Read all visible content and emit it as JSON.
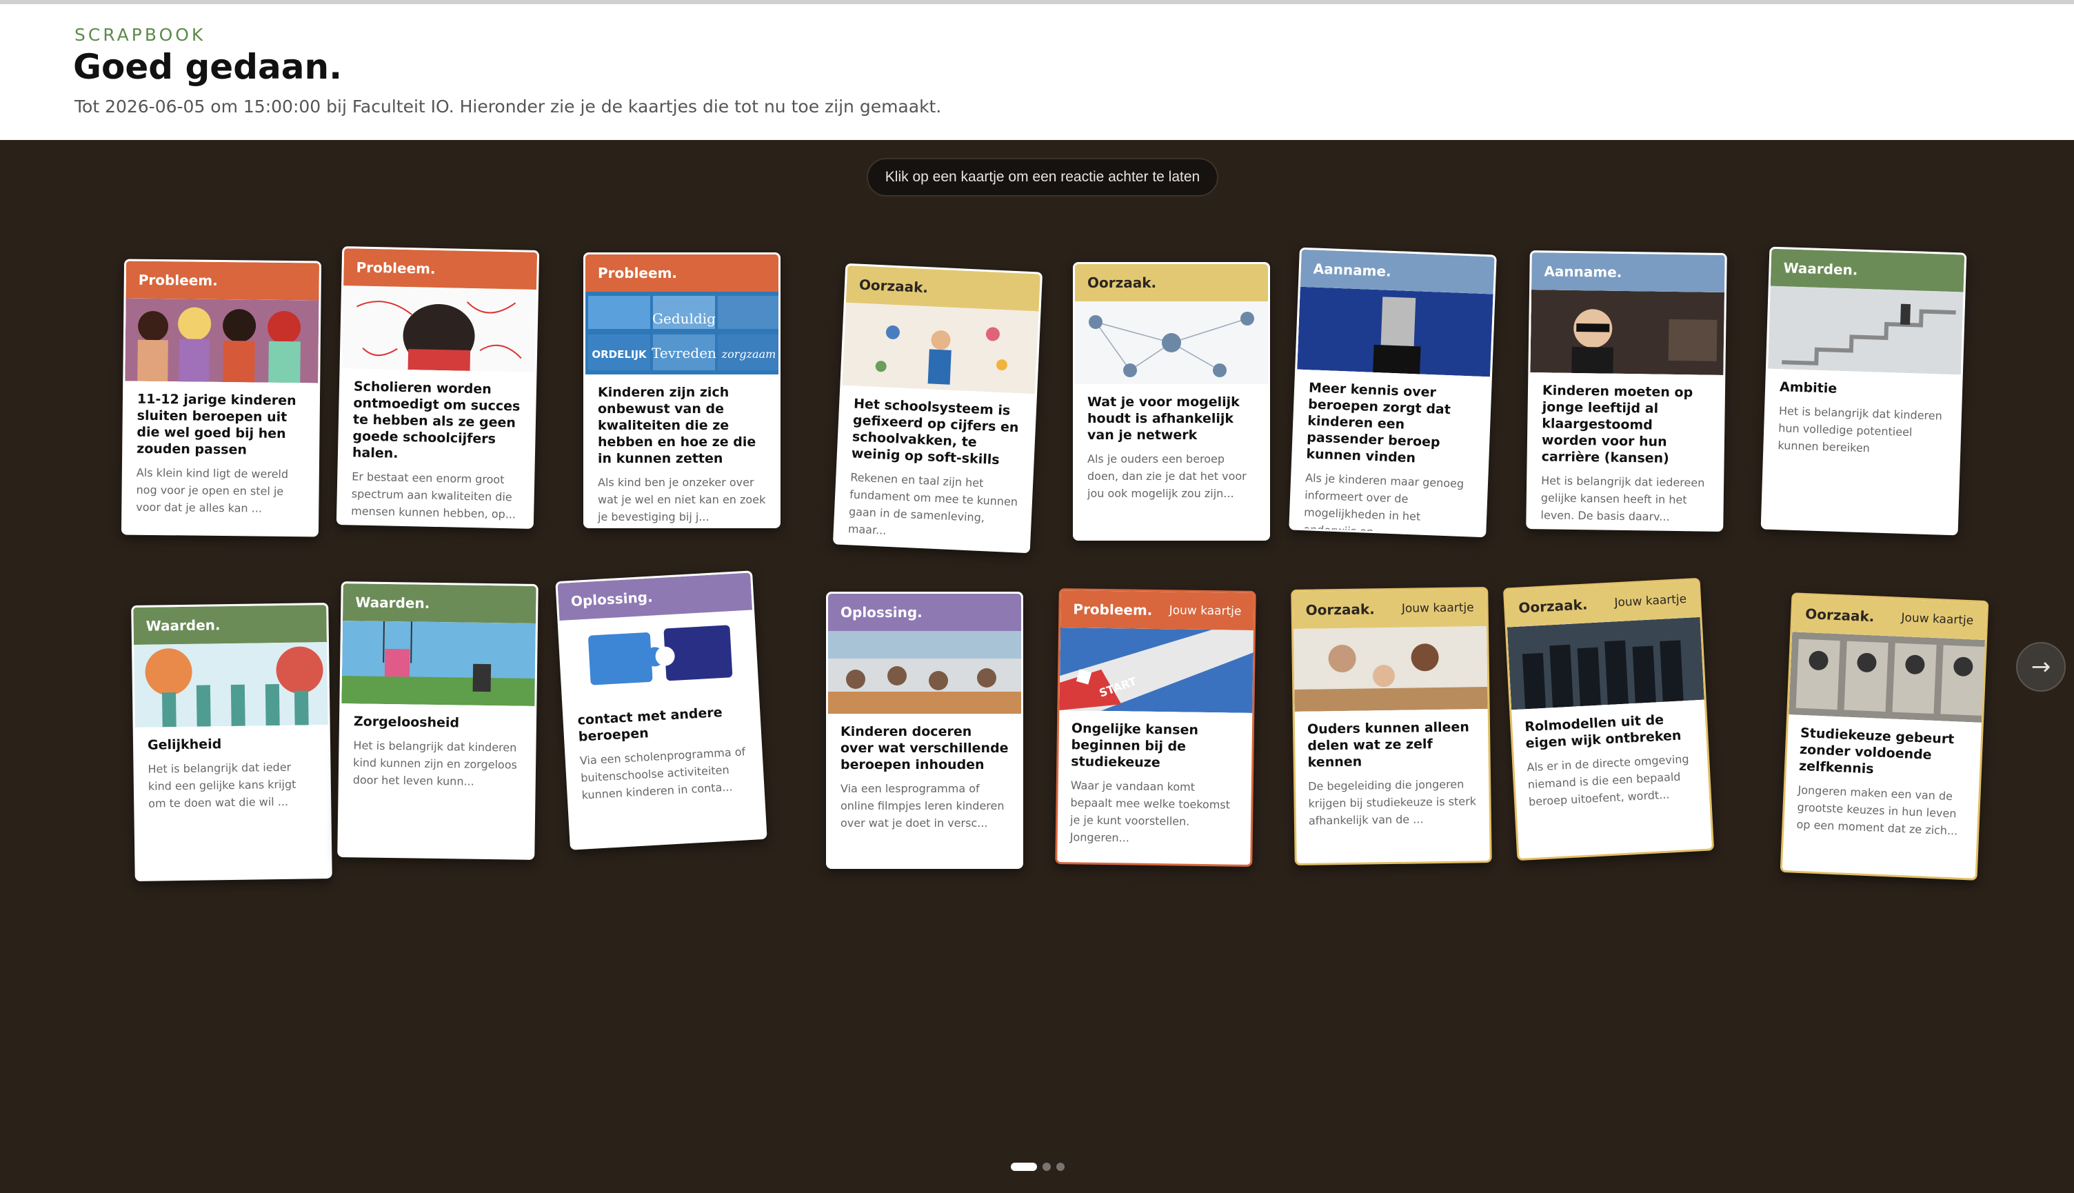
{
  "header": {
    "eyebrow": "SCRAPBOOK",
    "title": "Goed gedaan.",
    "subtitle": "Tot 2026-06-05 om 15:00:00 bij Faculteit IO. Hieronder zie je de kaartjes die tot nu toe zijn gemaakt."
  },
  "board": {
    "hint": "Klik op een kaartje om een reactie achter te laten",
    "next_icon": "arrow-right-icon",
    "next_glyph": "→",
    "pagination": {
      "pages": 3,
      "current": 1
    }
  },
  "colors": {
    "probleem": "#d9663c",
    "oorzaak": "#e3c874",
    "aanname": "#7a9cc2",
    "waarden": "#6b8c57",
    "oplossing": "#8f79b3",
    "background": "#2a2119"
  },
  "cards": [
    {
      "category": "Probleem.",
      "mine": "",
      "title": "11-12 jarige kinderen sluiten beroepen uit die wel goed bij hen zouden passen",
      "body": "Als klein kind ligt de wereld nog voor je open en stel je voor dat je alles kan ...",
      "image": "princesses"
    },
    {
      "category": "Probleem.",
      "mine": "",
      "title": "Scholieren worden ontmoedigt om succes te hebben als ze geen goede schoolcijfers halen.",
      "body": "Er bestaat een enorm groot spectrum aan kwaliteiten die mensen kunnen hebben, op...",
      "image": "sad-student"
    },
    {
      "category": "Probleem.",
      "mine": "",
      "title": "Kinderen zijn zich onbewust van de kwaliteiten die ze hebben en hoe ze die in kunnen zetten",
      "body": "Als kind ben je onzeker over wat je wel en niet kan en zoek je bevestiging bij j...",
      "image": "quality-cards",
      "image_words": [
        "Geduldig",
        "ORDELIJK",
        "Tevreden",
        "zorgzaam"
      ]
    },
    {
      "category": "Oorzaak.",
      "mine": "",
      "title": "Het schoolsysteem is gefixeerd op cijfers en schoolvakken, te weinig op soft-skills",
      "body": "Rekenen en taal zijn het fundament om mee te kunnen gaan in de samenleving, maar...",
      "image": "skills-illustration"
    },
    {
      "category": "Oorzaak.",
      "mine": "",
      "title": "Wat je voor mogelijk houdt is afhankelijk van je netwerk",
      "body": "Als je ouders een beroep doen, dan zie je dat het voor jou ook mogelijk zou zijn...",
      "image": "network"
    },
    {
      "category": "Aanname.",
      "mine": "",
      "title": "Meer kennis over beroepen zorgt dat kinderen een passender beroep kunnen vinden",
      "body": "Als je kinderen maar genoeg informeert over de mogelijkheden in het onderwijs en...",
      "image": "book-head"
    },
    {
      "category": "Aanname.",
      "mine": "",
      "title": "Kinderen moeten op jonge leeftijd al klaargestoomd worden voor hun carrière (kansen)",
      "body": "Het is belangrijk dat iedereen gelijke kansen heeft in het leven. De basis daarv...",
      "image": "baby-boss"
    },
    {
      "category": "Waarden.",
      "mine": "",
      "title": "Ambitie",
      "body": "Het is belangrijk dat kinderen hun volledige potentieel kunnen bereiken",
      "image": "stairs"
    },
    {
      "category": "Waarden.",
      "mine": "",
      "title": "Gelijkheid",
      "body": "Het is belangrijk dat ieder kind een gelijke kans krijgt om te doen wat die wil ...",
      "image": "equality"
    },
    {
      "category": "Waarden.",
      "mine": "",
      "title": "Zorgeloosheid",
      "body": "Het is belangrijk dat kinderen kind kunnen zijn en zorgeloos door het leven kunn...",
      "image": "swings"
    },
    {
      "category": "Oplossing.",
      "mine": "",
      "title": "contact met andere beroepen",
      "body": "Via een scholenprogramma of buitenschoolse activiteiten kunnen kinderen in conta...",
      "image": "puzzle"
    },
    {
      "category": "Oplossing.",
      "mine": "",
      "title": "Kinderen doceren over wat verschillende beroepen inhouden",
      "body": "Via een lesprogramma of online filmpjes leren kinderen over wat je doet in versc...",
      "image": "classroom"
    },
    {
      "category": "Probleem.",
      "mine": "Jouw kaartje",
      "title": "Ongelijke kansen beginnen bij de studiekeuze",
      "body": "Waar je vandaan komt bepaalt mee welke toekomst je je kunt voorstellen. Jongeren...",
      "image": "board-game",
      "image_words": [
        "START"
      ]
    },
    {
      "category": "Oorzaak.",
      "mine": "Jouw kaartje",
      "title": "Ouders kunnen alleen delen wat ze zelf kennen",
      "body": "De begeleiding die jongeren krijgen bij studiekeuze is sterk afhankelijk van de ...",
      "image": "family-table"
    },
    {
      "category": "Oorzaak.",
      "mine": "Jouw kaartje",
      "title": "Rolmodellen uit de eigen wijk ontbreken",
      "body": "Als er in de directe omgeving niemand is die een bepaald beroep uitoefent, wordt...",
      "image": "group"
    },
    {
      "category": "Oorzaak.",
      "mine": "Jouw kaartje",
      "title": "Studiekeuze gebeurt zonder voldoende zelfkennis",
      "body": "Jongeren maken een van de grootste keuzes in hun leven op een moment dat ze zich...",
      "image": "portraits"
    }
  ]
}
